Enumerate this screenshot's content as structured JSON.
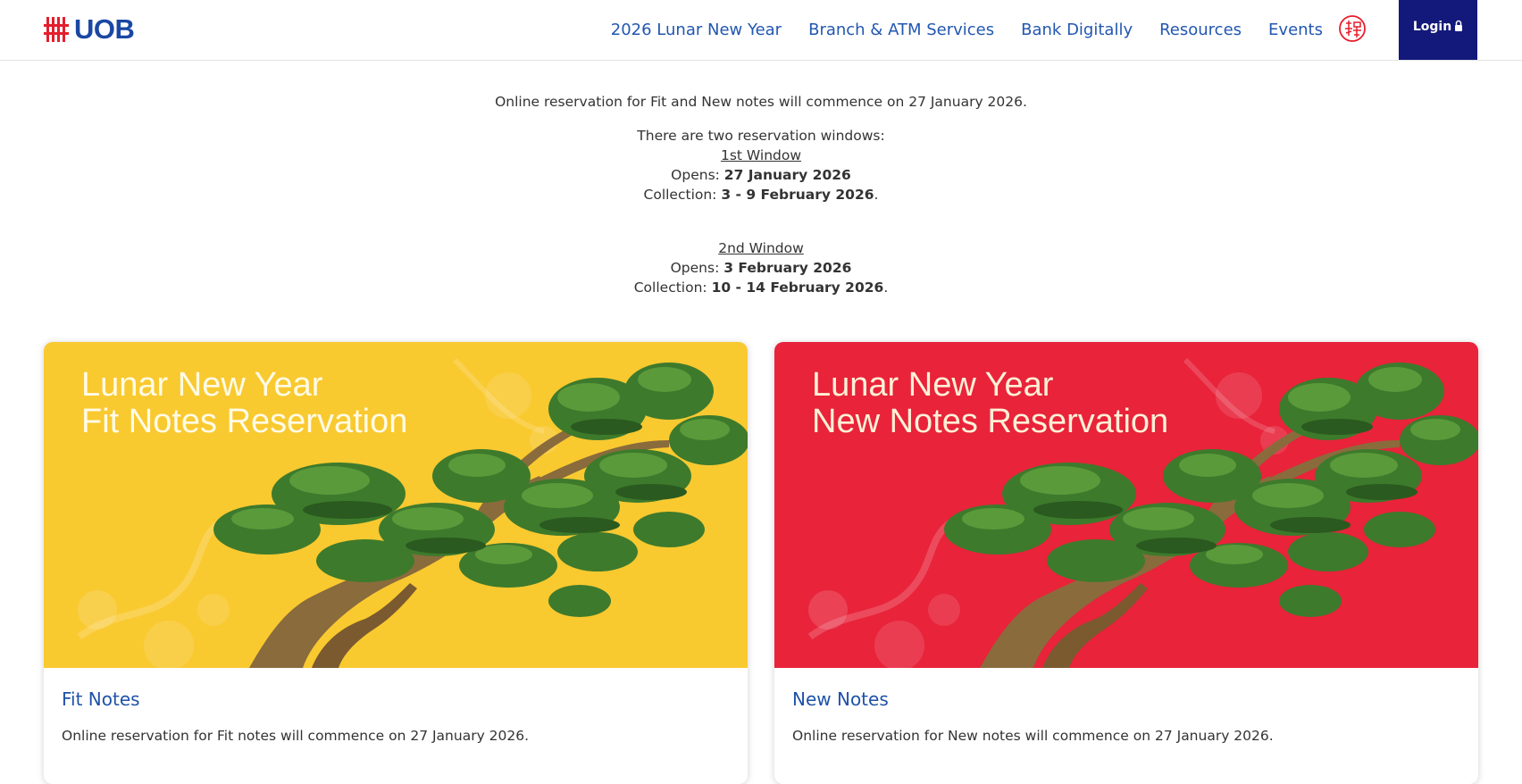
{
  "header": {
    "logo_text": "UOB",
    "nav": [
      "2026 Lunar New Year",
      "Branch & ATM Services",
      "Bank Digitally",
      "Resources",
      "Events"
    ],
    "language_icon": "chinese-character-icon",
    "login_label": "Login",
    "login_icon": "lock-icon"
  },
  "intro": {
    "line1": "Online reservation for Fit and New notes will commence on 27 January 2026.",
    "windows_heading": "There are two reservation windows:",
    "window1": {
      "title": "1st Window",
      "opens_label": "Opens: ",
      "opens_value": "27 January 2026",
      "collection_label": "Collection: ",
      "collection_value": "3 - 9 February 2026",
      "end": "."
    },
    "window2": {
      "title": "2nd Window",
      "opens_label": "Opens: ",
      "opens_value": "3 February 2026",
      "collection_label": "Collection: ",
      "collection_value": "10 - 14 February 2026",
      "end": "."
    }
  },
  "cards": [
    {
      "banner_line1": "Lunar New Year",
      "banner_line2": "Fit Notes Reservation",
      "title": "Fit Notes",
      "description": "Online reservation for Fit notes will commence on 27 January 2026.",
      "bg_color": "#f9c930"
    },
    {
      "banner_line1": "Lunar New Year",
      "banner_line2": "New Notes Reservation",
      "title": "New Notes",
      "description": "Online reservation for New notes will commence on 27 January 2026.",
      "bg_color": "#e8233a"
    }
  ],
  "colors": {
    "brand_blue": "#1a47a3",
    "brand_red": "#e41e2d",
    "link_blue": "#2257b0",
    "login_bg": "#13197a"
  }
}
